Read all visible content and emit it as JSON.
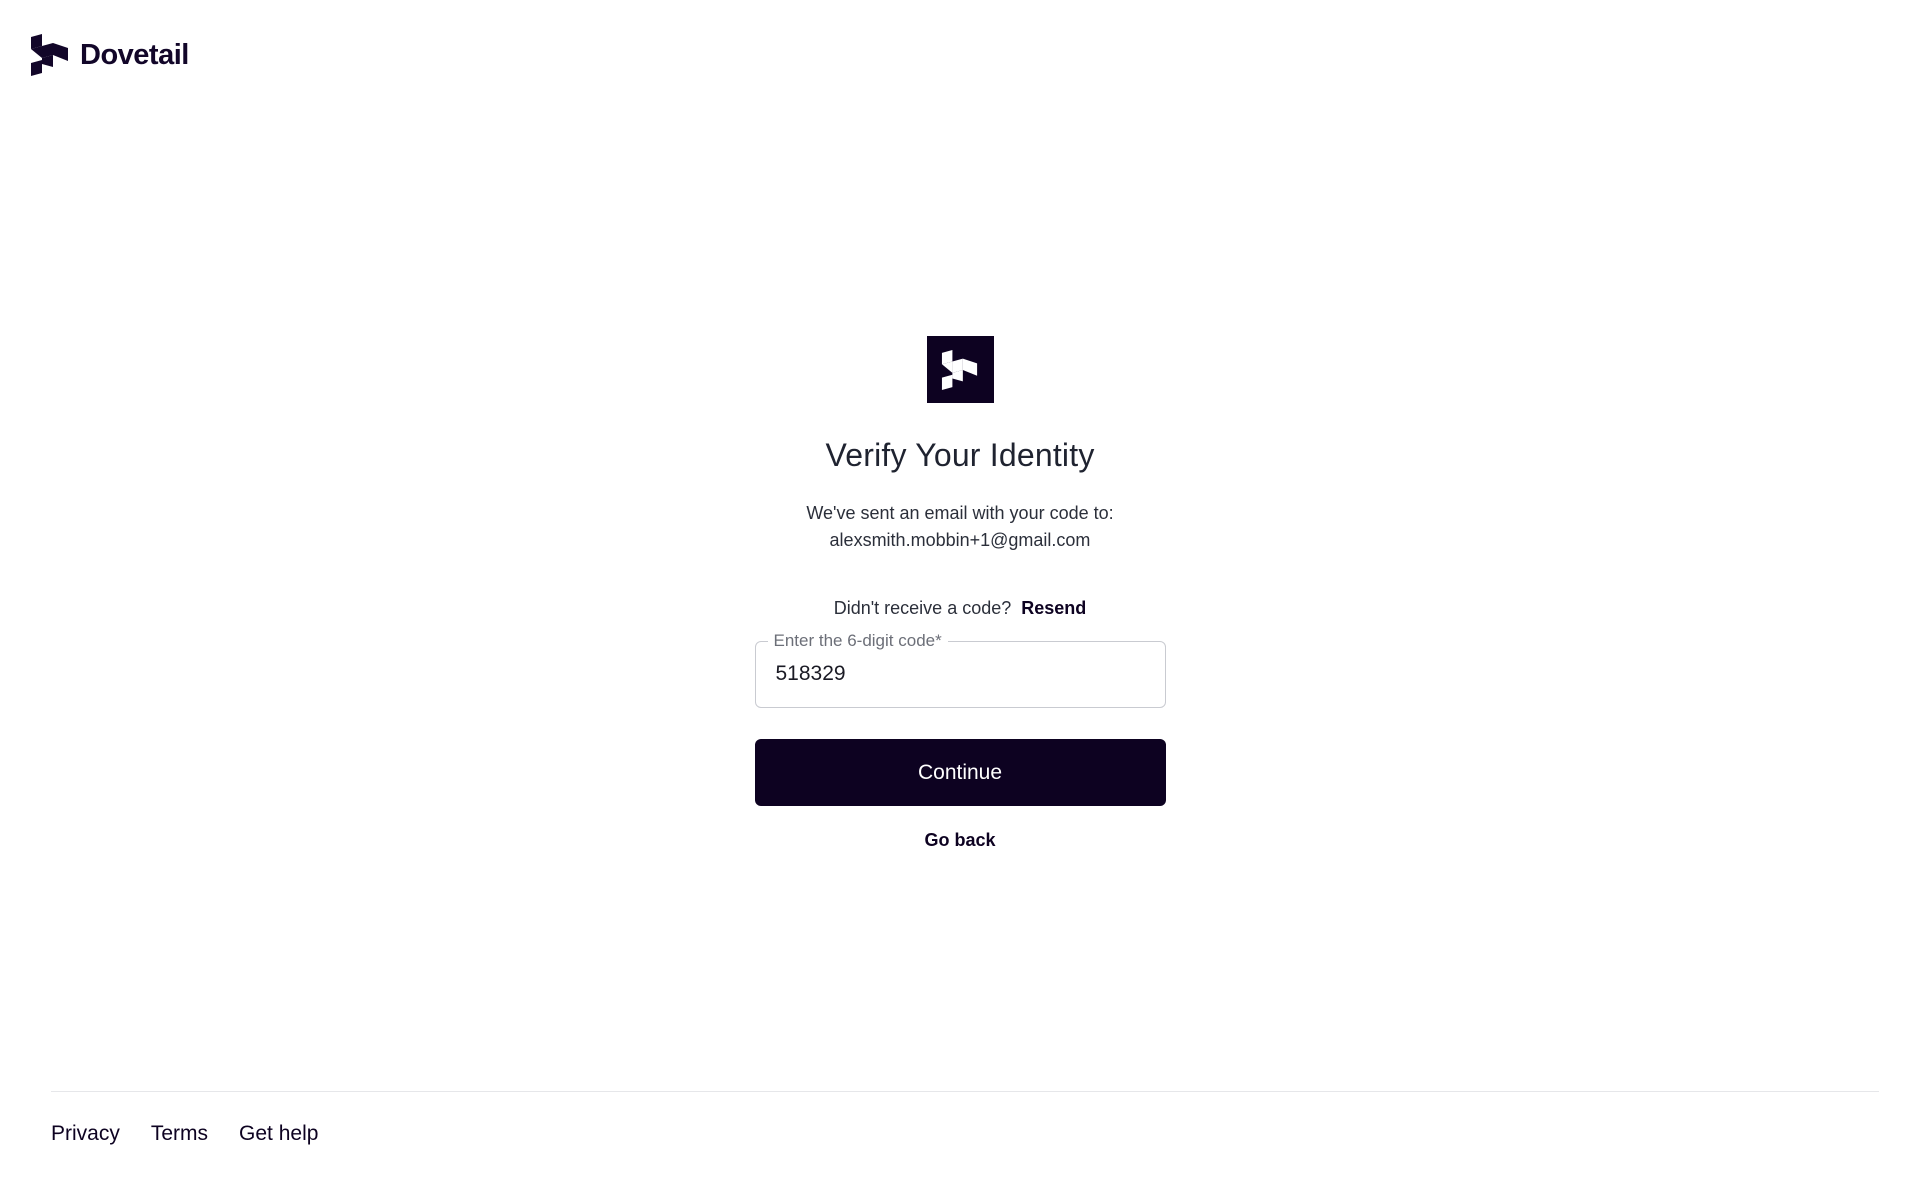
{
  "brand": {
    "name": "Dovetail",
    "logo_icon": "dovetail-logo-icon",
    "color": "#120629"
  },
  "card": {
    "logo_icon": "dovetail-logo-icon",
    "title": "Verify Your Identity",
    "subtitle_line1": "We've sent an email with your code to:",
    "email": "alexsmith.mobbin+1@gmail.com",
    "resend_prompt": "Didn't receive a code?",
    "resend_label": "Resend",
    "code_field": {
      "label": "Enter the 6-digit code*",
      "value": "518329"
    },
    "continue_label": "Continue",
    "go_back_label": "Go back"
  },
  "footer": {
    "links": [
      "Privacy",
      "Terms",
      "Get help"
    ]
  },
  "colors": {
    "primary": "#0d0221",
    "border": "#c9cbd1",
    "text": "#1f2330",
    "muted": "#6c6f78"
  }
}
